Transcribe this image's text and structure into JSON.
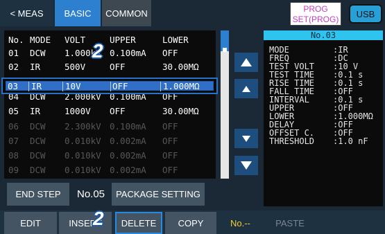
{
  "tabs": {
    "meas": "< MEAS",
    "basic": "BASIC",
    "common": "COMMON"
  },
  "prog_box": {
    "line1": "PROG",
    "line2": "SET(PROG)"
  },
  "usb_label": "USB",
  "table": {
    "headers": [
      "No.",
      "MODE",
      "VOLT",
      "UPPER",
      "LOWER"
    ],
    "rows": [
      [
        "01",
        "DCW",
        "1.000kV",
        "0.100mA",
        "OFF"
      ],
      [
        "02",
        "IR",
        "500V",
        "OFF",
        "30.00MΩ"
      ],
      [
        "03",
        "IR",
        "10V",
        "OFF",
        "1.000MΩ"
      ],
      [
        "04",
        "DCW",
        "2.000kV",
        "0.100mA",
        "OFF"
      ],
      [
        "05",
        "IR",
        "1000V",
        "OFF",
        "30.00MΩ"
      ],
      [
        "06",
        "DCW",
        "2.300kV",
        "0.100mA",
        "OFF"
      ],
      [
        "07",
        "DCW",
        "0.010kV",
        "0.002mA",
        "OFF"
      ],
      [
        "08",
        "DCW",
        "0.010kV",
        "0.002mA",
        "OFF"
      ],
      [
        "09",
        "DCW",
        "0.010kV",
        "0.002mA",
        "OFF"
      ]
    ]
  },
  "step_info": {
    "title": "No.03",
    "lines": [
      [
        "MODE",
        ":IR"
      ],
      [
        "FREQ",
        ":DC"
      ],
      [
        "TEST VOLT",
        ":10 V"
      ],
      [
        "TEST TIME",
        ":0.1 s"
      ],
      [
        "RISE TIME",
        ":0.1 s"
      ],
      [
        "FALL TIME",
        ":OFF"
      ],
      [
        "INTERVAL",
        ":0.1 s"
      ],
      [
        "UPPER",
        ":OFF"
      ],
      [
        "LOWER",
        ":1.000MΩ"
      ],
      [
        "DELAY",
        ":OFF"
      ],
      [
        "OFFSET C.",
        ":OFF"
      ],
      [
        "THRESHOLD",
        ":1.0 nF"
      ]
    ]
  },
  "controls": {
    "end_step": "END STEP",
    "step_value": "No.05",
    "package_setting": "PACKAGE SETTING"
  },
  "bottom": {
    "edit": "EDIT",
    "insert": "INSERT",
    "delete": "DELETE",
    "copy": "COPY",
    "no": "No.--",
    "paste": "PASTE"
  },
  "badges": [
    "2",
    "2"
  ],
  "colors": {
    "accent": "#2d7fd0",
    "highlight": "#f0d030",
    "panel": "#0b0b0b",
    "info_header": "#2fc4f0"
  }
}
